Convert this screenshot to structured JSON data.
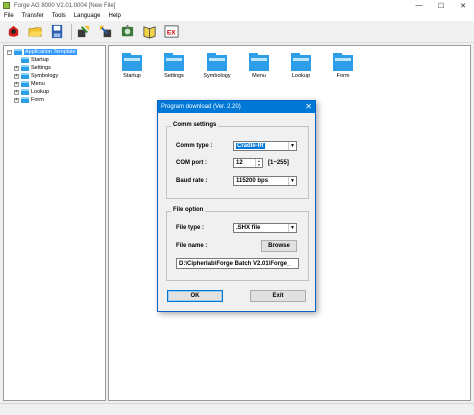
{
  "window": {
    "title": "Forge AG 8000 V2.01.0004 [New File]",
    "minimize": "—",
    "maximize": "☐",
    "close": "✕"
  },
  "menu": [
    "File",
    "Transfer",
    "Tools",
    "Language",
    "Help"
  ],
  "toolbar": [
    "new-icon",
    "open-icon",
    "save-icon",
    "download-icon",
    "upload-icon",
    "settings-icon",
    "book-icon",
    "exit-icon"
  ],
  "tree": {
    "root": "Application Template",
    "children": [
      "Startup",
      "Settings",
      "Symbology",
      "Menu",
      "Lookup",
      "Form"
    ]
  },
  "modules": [
    "Startup",
    "Settings",
    "Symbology",
    "Menu",
    "Lookup",
    "Form"
  ],
  "dialog": {
    "title": "Program download  (Ver. 2.20)",
    "close": "✕",
    "comm": {
      "group_title": "Comm settings",
      "comm_type_label": "Comm type :",
      "comm_type_value": "Cradle-IR",
      "com_port_label": "COM port :",
      "com_port_value": "12",
      "com_port_range": "[1~255]",
      "baud_rate_label": "Baud rate :",
      "baud_rate_value": "115200 bps"
    },
    "file": {
      "group_title": "File option",
      "file_type_label": "File type :",
      "file_type_value": ".SHX file",
      "file_name_label": "File name :",
      "browse_label": "Browse",
      "path_value": "D:\\Cipherlab\\Forge Batch V2.01\\Forge_"
    },
    "ok_label": "OK",
    "exit_label": "Exit"
  },
  "colors": {
    "accent": "#0078d7",
    "folder": "#2e9ee8"
  }
}
